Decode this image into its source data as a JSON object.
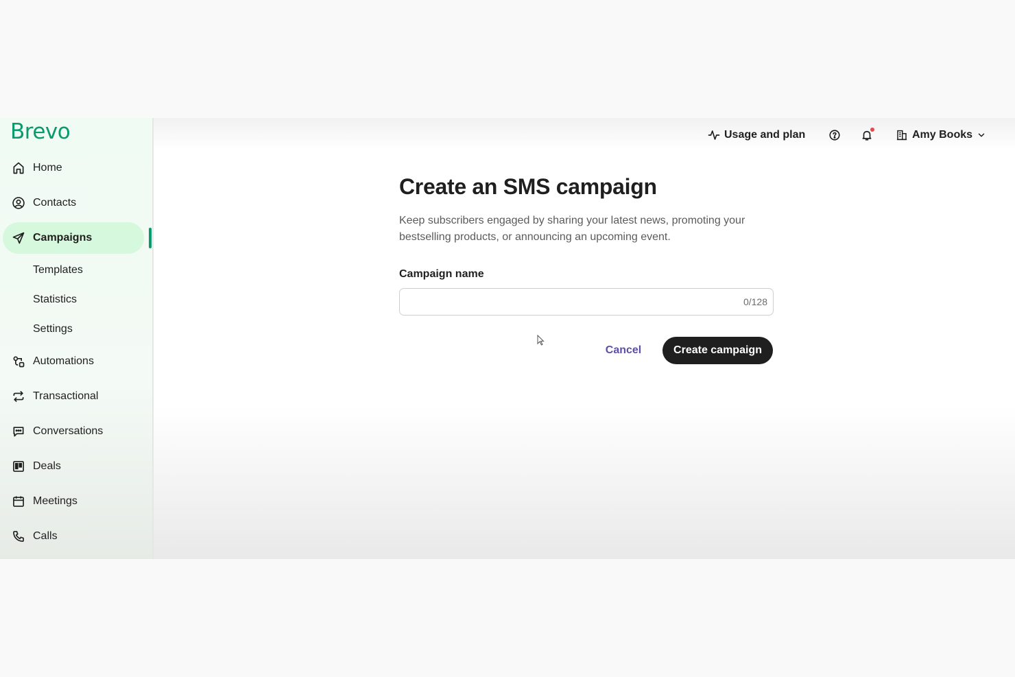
{
  "app": {
    "logo": "Brevo"
  },
  "header": {
    "usage_label": "Usage and plan",
    "account_name": "Amy Books"
  },
  "sidebar": {
    "items": [
      {
        "label": "Home",
        "icon": "home-icon"
      },
      {
        "label": "Contacts",
        "icon": "contacts-icon"
      },
      {
        "label": "Campaigns",
        "icon": "send-icon",
        "active": true
      },
      {
        "label": "Automations",
        "icon": "automation-icon"
      },
      {
        "label": "Transactional",
        "icon": "repeat-icon"
      },
      {
        "label": "Conversations",
        "icon": "chat-icon"
      },
      {
        "label": "Deals",
        "icon": "kanban-icon"
      },
      {
        "label": "Meetings",
        "icon": "calendar-icon"
      },
      {
        "label": "Calls",
        "icon": "phone-icon"
      }
    ],
    "subitems": [
      {
        "label": "Templates"
      },
      {
        "label": "Statistics"
      },
      {
        "label": "Settings"
      }
    ]
  },
  "main": {
    "title": "Create an SMS campaign",
    "description": "Keep subscribers engaged by sharing your latest news, promoting your bestselling products, or announcing an upcoming event.",
    "field_label": "Campaign name",
    "field_value": "",
    "counter": "0/128",
    "cancel_label": "Cancel",
    "create_label": "Create campaign"
  },
  "colors": {
    "brand": "#0b996e",
    "active_bg": "#d6f8dc",
    "primary_button": "#1f1f1f",
    "link": "#5b4fa8",
    "notification_dot": "#e5484d"
  }
}
